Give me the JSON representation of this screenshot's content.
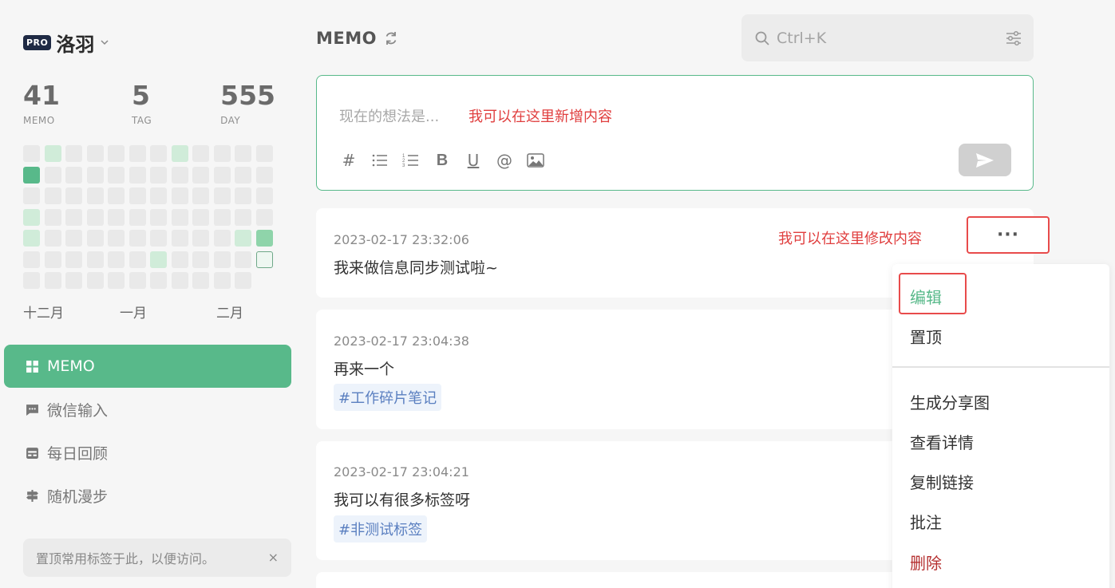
{
  "user": {
    "badge": "PRO",
    "name": "洛羽",
    "chevron": "⌄"
  },
  "stats": [
    {
      "value": "41",
      "label": "MEMO"
    },
    {
      "value": "5",
      "label": "TAG"
    },
    {
      "value": "555",
      "label": "DAY"
    }
  ],
  "heatmap": {
    "colors": {
      "empty": "#e9e9e9",
      "level1": "#d0ecd9",
      "level2": "#8fd4aa",
      "level3": "#58b98a"
    },
    "rows": [
      [
        0,
        1,
        0,
        0,
        0,
        0,
        0,
        1,
        0,
        0,
        0,
        0
      ],
      [
        3,
        0,
        0,
        0,
        0,
        0,
        0,
        0,
        0,
        0,
        0,
        0
      ],
      [
        0,
        0,
        0,
        0,
        0,
        0,
        0,
        0,
        0,
        0,
        0,
        0
      ],
      [
        1,
        0,
        0,
        0,
        0,
        0,
        0,
        0,
        0,
        0,
        0,
        0
      ],
      [
        1,
        0,
        0,
        0,
        0,
        0,
        0,
        0,
        0,
        0,
        1,
        2
      ],
      [
        0,
        0,
        0,
        0,
        0,
        0,
        1,
        0,
        0,
        0,
        0,
        9
      ],
      [
        0,
        0,
        0,
        0,
        0,
        0,
        0,
        0,
        0,
        0,
        0,
        -1
      ]
    ]
  },
  "months": [
    "十二月",
    "一月",
    "二月"
  ],
  "nav": [
    {
      "label": "MEMO",
      "icon": "grid-icon",
      "active": true
    },
    {
      "label": "微信输入",
      "icon": "chat-icon",
      "active": false
    },
    {
      "label": "每日回顾",
      "icon": "calendar-icon",
      "active": false
    },
    {
      "label": "随机漫步",
      "icon": "signpost-icon",
      "active": false
    }
  ],
  "tip": {
    "text": "置顶常用标签于此，以便访问。",
    "close": "×"
  },
  "main": {
    "title": "MEMO"
  },
  "search": {
    "placeholder": "Ctrl+K"
  },
  "editor": {
    "placeholder": "现在的想法是...",
    "annotation": "我可以在这里新增内容",
    "tools": {
      "hash": "#",
      "bold": "B",
      "underline": "U",
      "at": "@"
    }
  },
  "memos": [
    {
      "time": "2023-02-17 23:32:06",
      "text": "我来做信息同步测试啦~",
      "tag": ""
    },
    {
      "time": "2023-02-17 23:04:38",
      "text": "再来一个",
      "tag": "#工作碎片笔记"
    },
    {
      "time": "2023-02-17 23:04:21",
      "text": "我可以有很多标签呀",
      "tag": "#非测试标签"
    }
  ],
  "memo_annotation": "我可以在这里修改内容",
  "more_button": "···",
  "menu": {
    "edit": "编辑",
    "pin": "置顶",
    "share_image": "生成分享图",
    "details": "查看详情",
    "copy_link": "复制链接",
    "annotate": "批注",
    "delete": "删除"
  },
  "colors": {
    "accent": "#58b98a",
    "annotation": "#e03e3e",
    "delete": "#b53030",
    "tag_text": "#5a7fc0"
  }
}
